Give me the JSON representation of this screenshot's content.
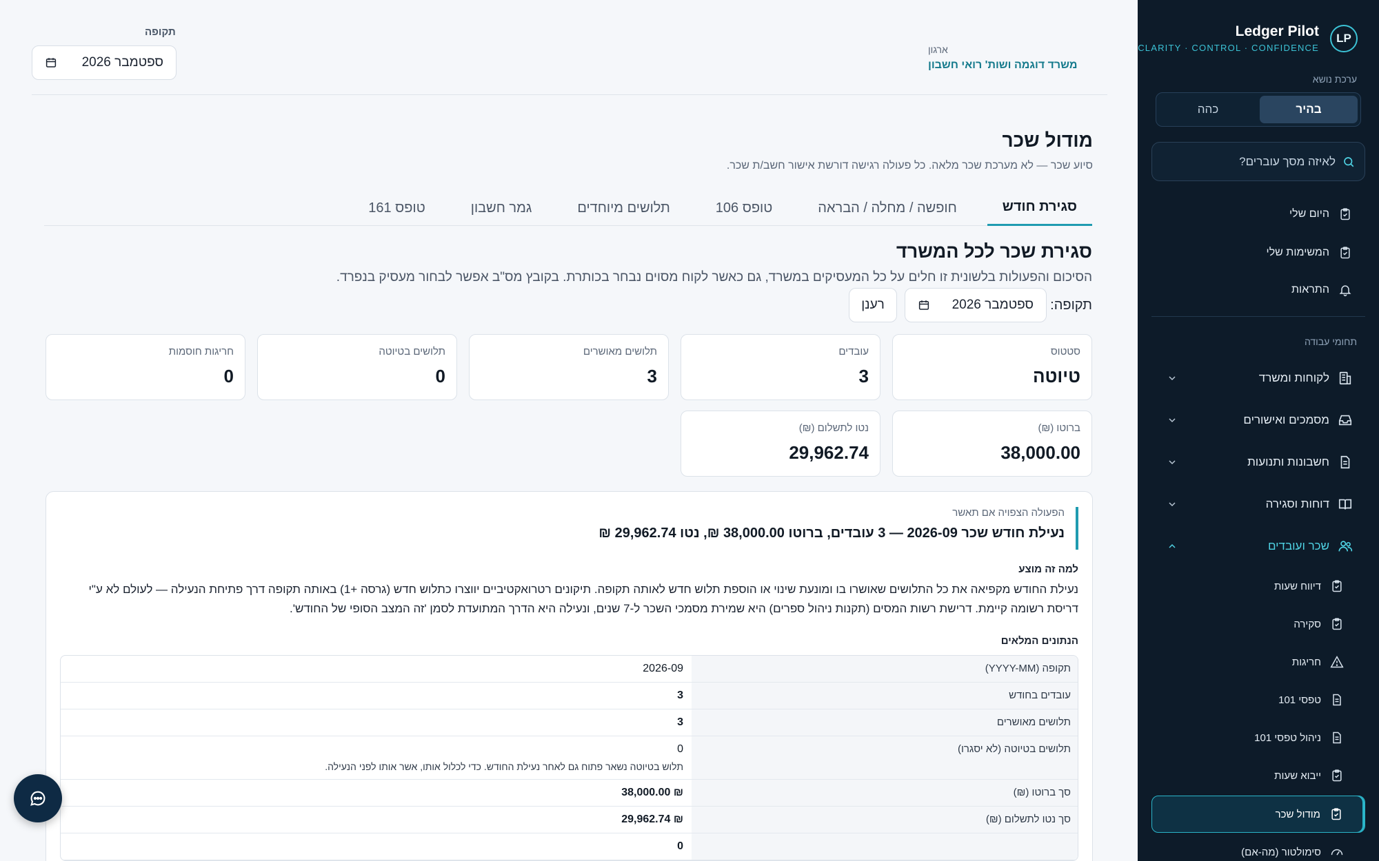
{
  "brand": {
    "name": "Ledger Pilot",
    "tagline": "CLARITY · CONTROL · CONFIDENCE",
    "logo": "LP"
  },
  "theme": {
    "label": "ערכת נושא",
    "light": "בהיר",
    "dark": "כהה",
    "selected": "light"
  },
  "search": {
    "placeholder": "לאיזה מסך עוברים?"
  },
  "nav_top": [
    {
      "label": "היום שלי",
      "icon": "clipboard-icon"
    },
    {
      "label": "המשימות שלי",
      "icon": "clipboard-icon"
    },
    {
      "label": "התראות",
      "icon": "bell-icon"
    }
  ],
  "nav_section": "תחומי עבודה",
  "nav_groups": [
    {
      "label": "לקוחות ומשרד",
      "icon": "building-icon"
    },
    {
      "label": "מסמכים ואישורים",
      "icon": "inbox-icon"
    },
    {
      "label": "חשבונות ותנועות",
      "icon": "file-icon"
    },
    {
      "label": "דוחות וסגירה",
      "icon": "book-icon"
    },
    {
      "label": "שכר ועובדים",
      "icon": "users-icon"
    }
  ],
  "nav_sub": [
    {
      "label": "דיווח שעות",
      "icon": "clipboard-icon"
    },
    {
      "label": "סקירה",
      "icon": "clipboard-icon"
    },
    {
      "label": "חריגות",
      "icon": "warning-icon"
    },
    {
      "label": "טפסי 101",
      "icon": "file-icon"
    },
    {
      "label": "ניהול טפסי 101",
      "icon": "file-icon"
    },
    {
      "label": "ייבוא שעות",
      "icon": "clipboard-icon"
    },
    {
      "label": "מודול שכר",
      "icon": "clipboard-icon"
    },
    {
      "label": "סימולטור (מה-אם)",
      "icon": "gauge-icon"
    }
  ],
  "header": {
    "period_label": "תקופה",
    "period_value": "ספטמבר 2026",
    "org_label": "ארגון",
    "org_name": "משרד דוגמה ושות' רואי חשבון"
  },
  "page": {
    "title": "מודול שכר",
    "subtitle": "סיוע שכר — לא מערכת שכר מלאה. כל פעולה רגישה דורשת אישור חשב/ת שכר."
  },
  "tabs": [
    "סגירת חודש",
    "חופשה / מחלה / הבראה",
    "טופס 106",
    "תלושים מיוחדים",
    "גמר חשבון",
    "טופס 161"
  ],
  "section": {
    "title": "סגירת שכר לכל המשרד",
    "subtitle": "הסיכום והפעולות בלשונית זו חלים על כל המעסיקים במשרד, גם כאשר לקוח מסוים נבחר בכותרת. בקובץ מס\"ב אפשר לבחור מעסיק בנפרד.",
    "period_label": "תקופה:",
    "period_value": "ספטמבר 2026",
    "refresh": "רענן"
  },
  "stats": [
    {
      "label": "סטטוס",
      "value": "טיוטה"
    },
    {
      "label": "עובדים",
      "value": "3"
    },
    {
      "label": "תלושים מאושרים",
      "value": "3"
    },
    {
      "label": "תלושים בטיוטה",
      "value": "0"
    },
    {
      "label": "חריגות חוסמות",
      "value": "0"
    },
    {
      "label": "ברוטו (₪)",
      "value": "38,000.00"
    },
    {
      "label": "נטו לתשלום (₪)",
      "value": "29,962.74"
    }
  ],
  "action": {
    "expect_label": "הפעולה הצפויה אם תאשר",
    "expect_title": "נעילת חודש שכר 2026-09 — 3 עובדים, ברוטו 38,000.00 ₪, נטו 29,962.74 ₪",
    "why_label": "למה זה מוצע",
    "why_text": "נעילת החודש מקפיאה את כל התלושים שאושרו בו ומונעת שינוי או הוספת תלוש חדש לאותה תקופה. תיקונים רטרואקטיביים יווצרו כתלוש חדש (גרסה +1) באותה תקופה דרך פתיחת הנעילה — לעולם לא ע\"י דריסת רשומה קיימת. דרישת רשות המסים (תקנות ניהול ספרים) היא שמירת מסמכי השכר ל-7 שנים, ונעילה היא הדרך המתועדת לסמן 'זה המצב הסופי של החודש'.",
    "data_label": "הנתונים המלאים",
    "rows": [
      {
        "key": "תקופה (YYYY-MM)",
        "value": "2026-09",
        "bold": false,
        "note": ""
      },
      {
        "key": "עובדים בחודש",
        "value": "3",
        "bold": true,
        "note": ""
      },
      {
        "key": "תלושים מאושרים",
        "value": "3",
        "bold": true,
        "note": ""
      },
      {
        "key": "תלושים בטיוטה (לא יסגרו)",
        "value": "0",
        "bold": false,
        "note": "תלוש בטיוטה נשאר פתוח גם לאחר נעילת החודש. כדי לכלול אותו, אשר אותו לפני הנעילה."
      },
      {
        "key": "סך ברוטו (₪)",
        "value": "₪ 38,000.00",
        "bold": true,
        "note": ""
      },
      {
        "key": "סך נטו לתשלום (₪)",
        "value": "₪ 29,962.74",
        "bold": true,
        "note": ""
      },
      {
        "key": "",
        "value": "0",
        "bold": true,
        "note": ""
      }
    ]
  },
  "chat": {
    "icon": "chat-icon"
  }
}
